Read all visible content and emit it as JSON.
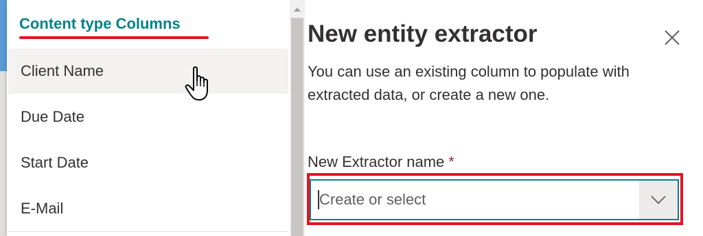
{
  "dropdown": {
    "group_header": "Content type Columns",
    "options": [
      {
        "label": "Client Name",
        "hovered": true
      },
      {
        "label": "Due Date"
      },
      {
        "label": "Start Date"
      },
      {
        "label": "E-Mail"
      }
    ]
  },
  "panel": {
    "title": "New entity extractor",
    "description": "You can use an existing column to populate with extracted data, or create a new one.",
    "field": {
      "label": "New Extractor name",
      "required_mark": "*",
      "placeholder": "Create or select",
      "value": ""
    }
  },
  "icons": {
    "close": "close-icon",
    "chevron": "chevron-down-icon",
    "scroll_up": "scroll-up-arrow-icon",
    "cursor": "hand-pointer-cursor"
  },
  "colors": {
    "accent_teal": "#038387",
    "annotation_red": "#e81123",
    "hover_bg": "#f3f2f1"
  }
}
